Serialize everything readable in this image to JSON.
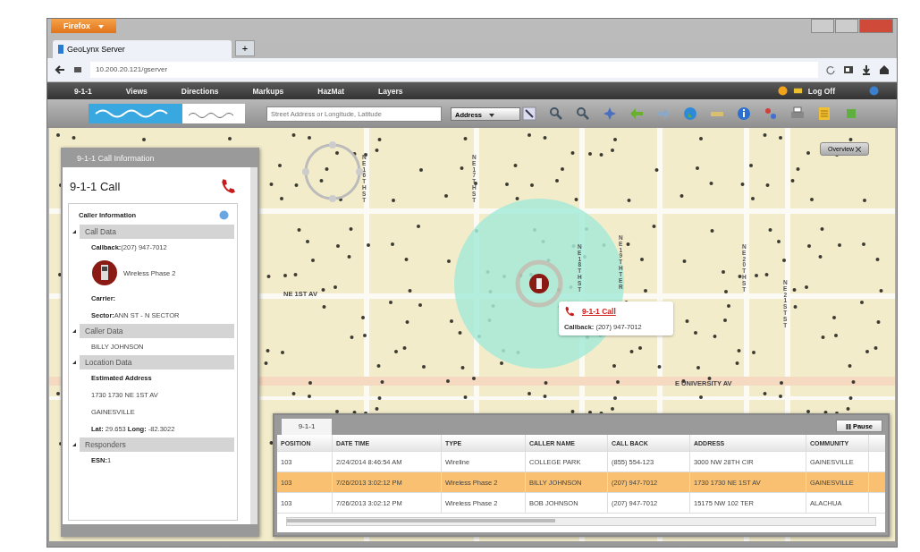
{
  "browser": {
    "menu_button": "Firefox",
    "tab": "GeoLynx Server",
    "new_tab": "+",
    "url": "10.200.20.121/gserver"
  },
  "menu": {
    "items": [
      "9-1-1",
      "Views",
      "Directions",
      "Markups",
      "HazMat",
      "Layers"
    ],
    "logoff": "Log Off"
  },
  "toolbar": {
    "search": {
      "placeholder": "Street Address or Longitude, Latitude"
    },
    "mode": "Address"
  },
  "map": {
    "streets": [
      {
        "name": "NE 16TH ST",
        "kind": "vertical"
      },
      {
        "name": "NE 17TH ST",
        "kind": "vertical"
      },
      {
        "name": "NE 18TH ST",
        "kind": "vertical"
      },
      {
        "name": "NE 19TH TER",
        "kind": "vertical"
      },
      {
        "name": "NE 20TH ST",
        "kind": "vertical"
      },
      {
        "name": "NE 21ST ST",
        "kind": "vertical"
      },
      {
        "name": "NE 1ST AV",
        "kind": "horizontal"
      },
      {
        "name": "E UNIVERSITY AV",
        "kind": "horizontal"
      }
    ],
    "overview": "Overview",
    "popup": {
      "title": "9-1-1 Call",
      "callback_label": "Callback:",
      "callback": "(207) 947-7012"
    }
  },
  "call_panel": {
    "title": "9-1-1 Call Information",
    "heading": "9-1-1 Call",
    "caller_info": "Caller Information",
    "sections": [
      {
        "title": "Call Data",
        "expanded": true,
        "lines": [
          {
            "kind": "field",
            "label": "Callback:",
            "value": "(207) 947-7012"
          },
          {
            "kind": "phone",
            "value": "Wireless Phase 2"
          },
          {
            "kind": "field",
            "label": "Carrier:"
          },
          {
            "kind": "field",
            "label": "Sector:",
            "value": "ANN ST - N SECTOR"
          }
        ]
      },
      {
        "title": "Caller Data",
        "expanded": true,
        "lines": [
          {
            "kind": "text",
            "value": "BILLY JOHNSON"
          }
        ]
      },
      {
        "title": "Location Data",
        "expanded": true,
        "lines": [
          {
            "kind": "bold",
            "value": "Estimated Address"
          },
          {
            "kind": "text",
            "value": "1730 1730 NE 1ST AV"
          },
          {
            "kind": "text",
            "value": "GAINESVILLE"
          },
          {
            "kind": "latlong",
            "label": "Lat:",
            "value": "29.653",
            "label2": "Long:",
            "value2": "-82.3022"
          }
        ]
      },
      {
        "title": "Responders",
        "expanded": true,
        "lines": [
          {
            "kind": "field",
            "label": "ESN:",
            "value": "1"
          }
        ]
      }
    ]
  },
  "calls_table": {
    "tabs": [
      {
        "label": "9-1-1",
        "selected": true
      }
    ],
    "pause": "Pause",
    "columns": [
      "POSITION",
      "DATE TIME",
      "TYPE",
      "CALLER NAME",
      "CALL BACK",
      "ADDRESS",
      "COMMUNITY"
    ],
    "rows": [
      {
        "cells": [
          "103",
          "2/24/2014 8:46:54 AM",
          "Wireline",
          "COLLEGE PARK",
          "(855) 554-123",
          "3000 NW 28TH CIR",
          "GAINESVILLE"
        ],
        "selected": false
      },
      {
        "cells": [
          "103",
          "7/26/2013 3:02:12 PM",
          "Wireless Phase 2",
          "BILLY JOHNSON",
          "(207) 947-7012",
          "1730 1730 NE 1ST AV",
          "GAINESVILLE"
        ],
        "selected": true
      },
      {
        "cells": [
          "103",
          "7/26/2013 3:02:12 PM",
          "Wireless Phase 2",
          "BOB JOHNSON",
          "(207) 947-7012",
          "15175 NW 102 TER",
          "ALACHUA"
        ],
        "selected": false
      }
    ]
  }
}
